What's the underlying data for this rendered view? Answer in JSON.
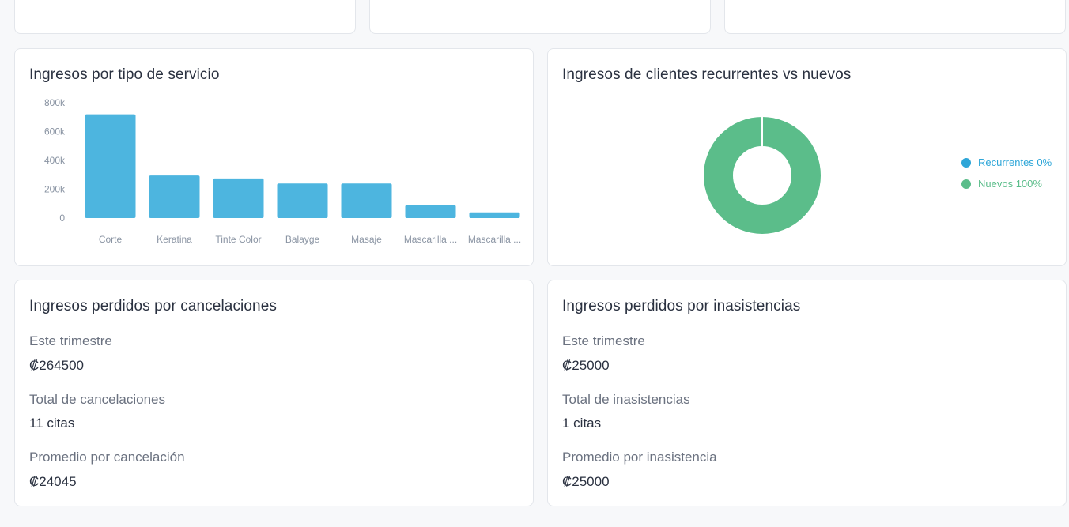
{
  "service_card": {
    "title": "Ingresos por tipo de servicio"
  },
  "clients_card": {
    "title": "Ingresos de clientes recurrentes vs nuevos",
    "legend": [
      {
        "label": "Recurrentes 0%",
        "color": "#2ea6d8"
      },
      {
        "label": "Nuevos 100%",
        "color": "#5bbd8a"
      }
    ]
  },
  "cancel_card": {
    "title": "Ingresos perdidos por cancelaciones",
    "stats": [
      {
        "label": "Este trimestre",
        "value": "₡264500"
      },
      {
        "label": "Total de cancelaciones",
        "value": "11 citas"
      },
      {
        "label": "Promedio por cancelación",
        "value": "₡24045"
      }
    ]
  },
  "noshow_card": {
    "title": "Ingresos perdidos por inasistencias",
    "stats": [
      {
        "label": "Este trimestre",
        "value": "₡25000"
      },
      {
        "label": "Total de inasistencias",
        "value": "1 citas"
      },
      {
        "label": "Promedio por inasistencia",
        "value": "₡25000"
      }
    ]
  },
  "chart_data": [
    {
      "type": "bar",
      "title": "Ingresos por tipo de servicio",
      "categories": [
        "Corte",
        "Keratina",
        "Tinte Color",
        "Balayge",
        "Masaje",
        "Mascarilla ...",
        "Mascarilla ..."
      ],
      "values": [
        720000,
        295000,
        275000,
        240000,
        240000,
        90000,
        40000
      ],
      "yticks": [
        "0",
        "200k",
        "400k",
        "600k",
        "800k"
      ],
      "ylim": [
        0,
        800000
      ],
      "color": "#4db5df",
      "grid": false
    },
    {
      "type": "pie",
      "title": "Ingresos de clientes recurrentes vs nuevos",
      "labels": [
        "Recurrentes",
        "Nuevos"
      ],
      "values": [
        0,
        100
      ],
      "colors": [
        "#2ea6d8",
        "#5bbd8a"
      ],
      "legend": "right"
    }
  ]
}
